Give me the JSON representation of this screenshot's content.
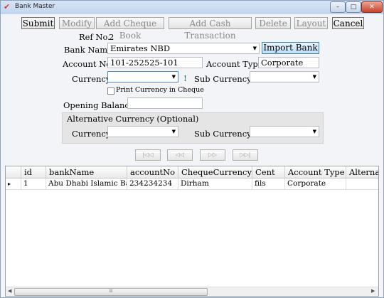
{
  "window": {
    "title": "Bank Master",
    "app_icon": "check-icon",
    "controls": {
      "minimize": "–",
      "maximize": "□",
      "close": "✕"
    }
  },
  "toolbar": {
    "submit": "Submit",
    "modify": "Modify",
    "add_cheque_book": "Add Cheque Book",
    "add_cash_transaction": "Add Cash Transaction",
    "delete": "Delete",
    "layout": "Layout",
    "cancel": "Cancel"
  },
  "form": {
    "ref_no_label": "Ref No.",
    "ref_no_value": "2",
    "bank_name_label": "Bank Name",
    "bank_name_value": "Emirates NBD",
    "import_bank": "Import Bank",
    "account_no_label": "Account No.",
    "account_no_value": "101-252525-101",
    "account_type_label": "Account Type:",
    "account_type_value": "Corporate",
    "currency_label": "Currency",
    "currency_value": "",
    "currency_warning": "!",
    "sub_currency_label": "Sub Currency:",
    "sub_currency_value": "",
    "print_currency_label": "Print Currency in Cheque",
    "print_currency_checked": false,
    "opening_balance_label": "Opening Balance",
    "opening_balance_value": ""
  },
  "alt_currency": {
    "legend": "Alternative Currency (Optional)",
    "currency_label": "Currency",
    "currency_value": "",
    "sub_currency_label": "Sub Currency:",
    "sub_currency_value": ""
  },
  "navigator": {
    "first": "|◁◁",
    "prev": "◁◁",
    "next": "▷▷",
    "last": "▷▷|"
  },
  "grid": {
    "columns": [
      "id",
      "bankName",
      "accountNo",
      "ChequeCurrency",
      "Cent",
      "Account Type",
      "Alternati"
    ],
    "rows": [
      {
        "indicator": "▸",
        "cells": [
          "1",
          "Abu Dhabi Islamic Bank",
          "234234234",
          "Dirham",
          "fils",
          "Corporate",
          ""
        ]
      }
    ],
    "scroll_thumb": "III"
  },
  "colors": {
    "accent": "#3c7fb1",
    "warning": "#2e8b57"
  }
}
